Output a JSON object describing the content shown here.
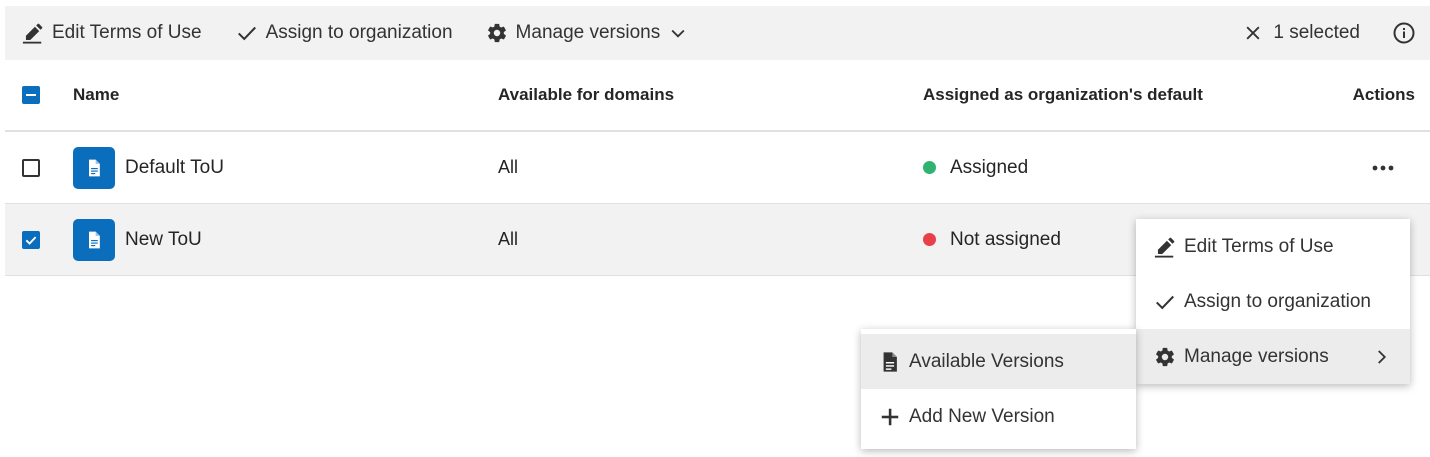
{
  "toolbar": {
    "edit_label": "Edit Terms of Use",
    "assign_label": "Assign to organization",
    "manage_label": "Manage versions",
    "selected_label": "1 selected"
  },
  "table": {
    "headers": {
      "name": "Name",
      "domains": "Available for domains",
      "assigned": "Assigned as organization's default",
      "actions": "Actions"
    },
    "rows": [
      {
        "name": "Default ToU",
        "domains": "All",
        "status": "Assigned",
        "status_color": "#2fb36e",
        "checked": false
      },
      {
        "name": "New ToU",
        "domains": "All",
        "status": "Not assigned",
        "status_color": "#e8404a",
        "checked": true
      }
    ]
  },
  "context_menu": {
    "items": [
      "Edit Terms of Use",
      "Assign to organization",
      "Manage versions"
    ]
  },
  "submenu": {
    "items": [
      "Available Versions",
      "Add New Version"
    ]
  },
  "colors": {
    "accent": "#0a6ebd",
    "toolbar_bg": "#f2f2f2",
    "selected_row_bg": "#f2f2f2"
  }
}
